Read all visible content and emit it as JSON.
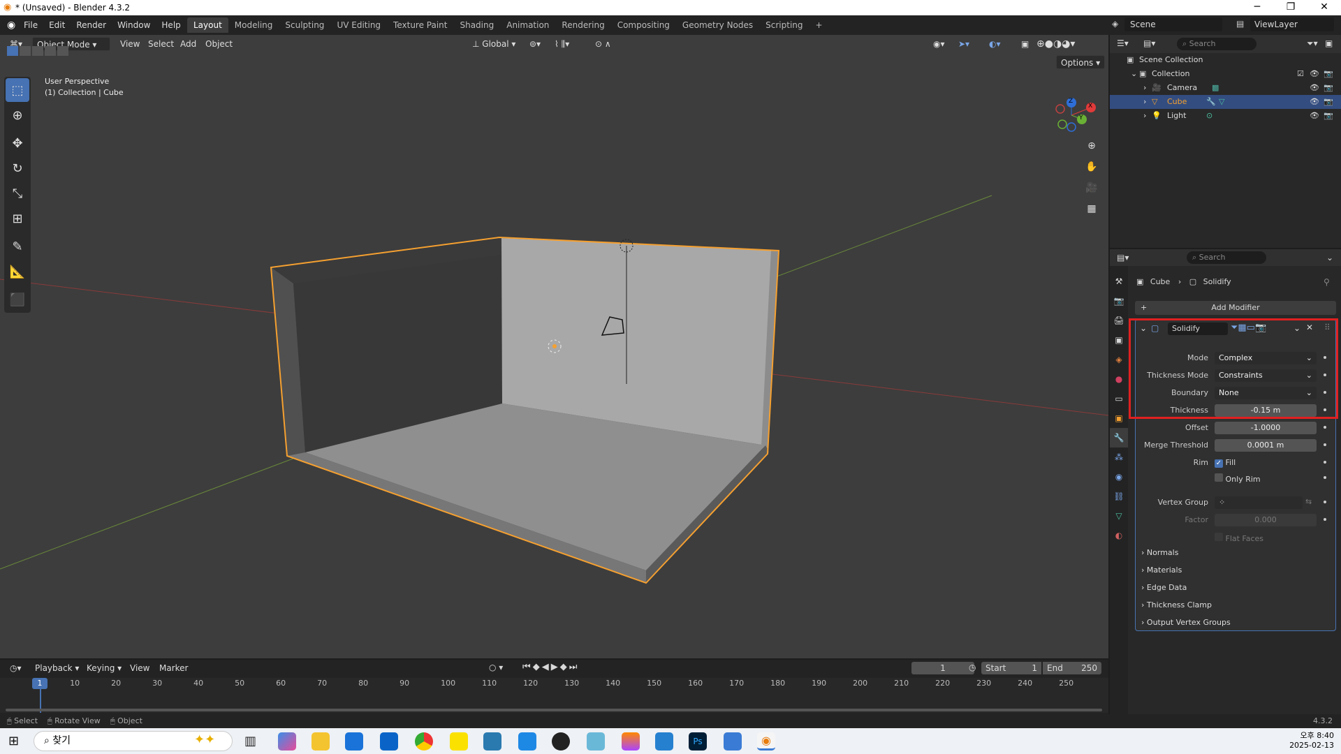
{
  "window": {
    "title": "* (Unsaved) - Blender 4.3.2"
  },
  "menu": [
    "File",
    "Edit",
    "Render",
    "Window",
    "Help"
  ],
  "workspaces": [
    "Layout",
    "Modeling",
    "Sculpting",
    "UV Editing",
    "Texture Paint",
    "Shading",
    "Animation",
    "Rendering",
    "Compositing",
    "Geometry Nodes",
    "Scripting"
  ],
  "active_workspace": "Layout",
  "scene_name": "Scene",
  "view_layer": "ViewLayer",
  "viewport": {
    "mode": "Object Mode",
    "menus": [
      "View",
      "Select",
      "Add",
      "Object"
    ],
    "orientation": "Global",
    "options_label": "Options",
    "overlay_line1": "User Perspective",
    "overlay_line2": "(1) Collection | Cube",
    "gizmo_axes": [
      "Z",
      "Y",
      "X"
    ]
  },
  "outliner": {
    "search_placeholder": "Search",
    "root": "Scene Collection",
    "collection": "Collection",
    "items": [
      "Camera",
      "Cube",
      "Light"
    ],
    "selected": "Cube"
  },
  "properties": {
    "search_placeholder": "Search",
    "breadcrumb_object": "Cube",
    "breadcrumb_modifier": "Solidify",
    "add_modifier": "Add Modifier",
    "modifier_name": "Solidify",
    "fields": {
      "mode_label": "Mode",
      "mode_value": "Complex",
      "thickness_mode_label": "Thickness Mode",
      "thickness_mode_value": "Constraints",
      "boundary_label": "Boundary",
      "boundary_value": "None",
      "thickness_label": "Thickness",
      "thickness_value": "-0.15 m",
      "offset_label": "Offset",
      "offset_value": "-1.0000",
      "merge_label": "Merge Threshold",
      "merge_value": "0.0001 m",
      "rim_label": "Rim",
      "fill_label": "Fill",
      "only_rim_label": "Only Rim",
      "vertex_group_label": "Vertex Group",
      "factor_label": "Factor",
      "factor_value": "0.000",
      "flat_faces_label": "Flat Faces"
    },
    "subpanels": [
      "Normals",
      "Materials",
      "Edge Data",
      "Thickness Clamp",
      "Output Vertex Groups"
    ]
  },
  "timeline": {
    "menus": [
      "Playback",
      "Keying",
      "View",
      "Marker"
    ],
    "current_frame": "1",
    "start_label": "Start",
    "start_value": "1",
    "end_label": "End",
    "end_value": "250",
    "ticks": [
      "1",
      "10",
      "20",
      "30",
      "40",
      "50",
      "60",
      "70",
      "80",
      "90",
      "100",
      "110",
      "120",
      "130",
      "140",
      "150",
      "160",
      "170",
      "180",
      "190",
      "200",
      "210",
      "220",
      "230",
      "240",
      "250"
    ]
  },
  "statusbar": {
    "items": [
      "Select",
      "Rotate View",
      "Object"
    ],
    "version": "4.3.2"
  },
  "taskbar": {
    "search_label": "찾기",
    "time": "오후 8:40",
    "date": "2025-02-13"
  },
  "colors": {
    "accent": "#4772b3",
    "selection": "#334d80",
    "highlight_box": "#e02020",
    "object_outline": "#f5a030"
  }
}
